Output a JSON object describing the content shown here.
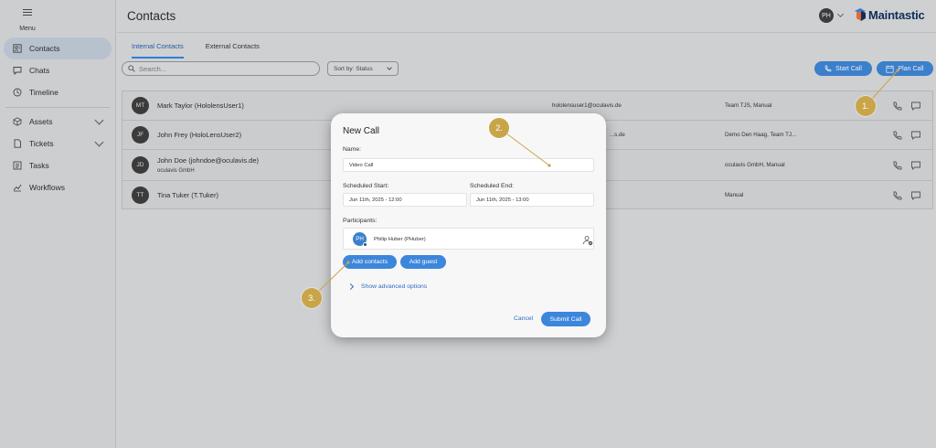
{
  "sidebar": {
    "menu_label": "Menu",
    "items": [
      {
        "label": "Contacts",
        "icon": "contacts-icon"
      },
      {
        "label": "Chats",
        "icon": "chat-icon"
      },
      {
        "label": "Timeline",
        "icon": "clock-icon"
      },
      {
        "label": "Assets",
        "icon": "cube-icon"
      },
      {
        "label": "Tickets",
        "icon": "ticket-icon"
      },
      {
        "label": "Tasks",
        "icon": "tasks-icon"
      },
      {
        "label": "Workflows",
        "icon": "workflow-icon"
      }
    ]
  },
  "header": {
    "title": "Contacts",
    "user_initials": "PH",
    "brand": "Maintastic"
  },
  "tabs": [
    {
      "label": "Internal Contacts"
    },
    {
      "label": "External Contacts"
    }
  ],
  "toolbar": {
    "search_placeholder": "Search...",
    "sort_value": "Sort by: Status",
    "start_call": "Start Call",
    "plan_call": "Plan Call"
  },
  "contacts": [
    {
      "initials": "MT",
      "name": "Mark Taylor (HololensUser1)",
      "company": "",
      "email": "hololensuser1@oculavis.de",
      "teams": "Team TJS, Manual"
    },
    {
      "initials": "JF",
      "name": "John Frey (HoloLensUser2)",
      "company": "",
      "email": "...s.de",
      "teams": "Demo Den Haag, Team TJ..."
    },
    {
      "initials": "JD",
      "name": "John Doe (johndoe@oculavis.de)",
      "company": "oculavis GmbH",
      "email": "",
      "teams": "oculavis GmbH, Manual"
    },
    {
      "initials": "TT",
      "name": "Tina Tuker (T.Tuker)",
      "company": "",
      "email": "",
      "teams": "Manual"
    }
  ],
  "modal": {
    "title": "New Call",
    "name_label": "Name:",
    "name_value": "Video Call",
    "start_label": "Scheduled Start:",
    "start_value": "Jun 11th, 2025 - 12:00",
    "end_label": "Scheduled End:",
    "end_value": "Jun 11th, 2025 - 13:00",
    "participants_label": "Participants:",
    "participant": {
      "initials": "PH",
      "name": "Philip Huber (PHuber)"
    },
    "add_contacts": "Add contacts",
    "add_guest": "Add guest",
    "advanced": "Show advanced options",
    "cancel": "Cancel",
    "submit": "Submit Call"
  },
  "steps": [
    "1.",
    "2.",
    "3."
  ],
  "colors": {
    "accent": "#3c86db",
    "brand": "#0f2f5a",
    "callout": "#c9a54a"
  }
}
